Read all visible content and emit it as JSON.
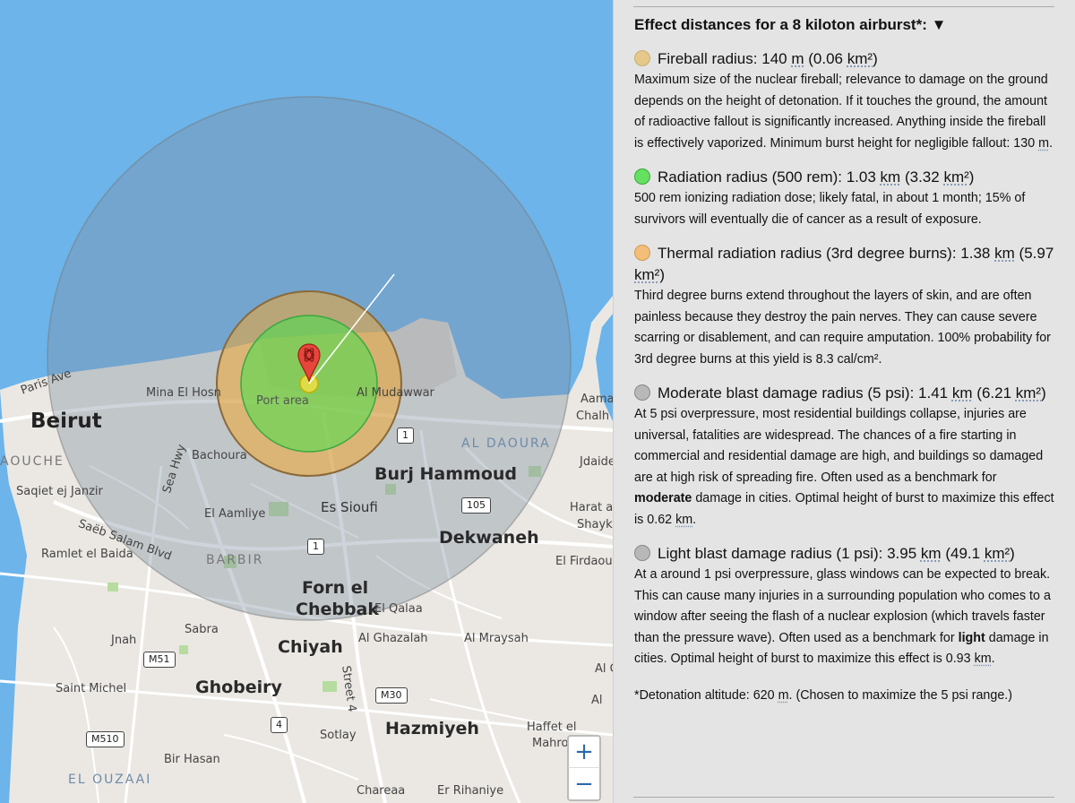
{
  "map": {
    "labels": {
      "beirut": "Beirut",
      "paris_ave": "Paris Ave",
      "mina_el_hosn": "Mina El Hosn",
      "port_area": "Port area",
      "al_mudawwar": "Al Mudawwar",
      "aouche": "AOUCHE",
      "bachoura": "Bachoura",
      "saqiet": "Saqiet ej Janzir",
      "sea_hwy": "Sea Hwy",
      "el_aamliye": "El Aamliye",
      "es_sioufi": "Es Sioufi",
      "burj_hammoud": "Burj Hammoud",
      "al_daoura": "AL DAOURA",
      "jdaide": "Jdaide",
      "aama": "Aama",
      "chalh": "Chalh",
      "saeb_salam": "Saëb Salam Blvd",
      "ramlet": "Ramlet el Baida",
      "barbir": "BARBIR",
      "dekwaneh": "Dekwaneh",
      "harat": "Harat a",
      "shayk": "Shayk",
      "el_firdaou": "El Firdaou",
      "forn_el": "Forn el",
      "chebbak": "Chebbak",
      "el_qalaa": "El Qalaa",
      "jnah": "Jnah",
      "sabra": "Sabra",
      "chiyah": "Chiyah",
      "al_ghazalah": "Al Ghazalah",
      "al_mraysah": "Al Mraysah",
      "saint_michel": "Saint Michel",
      "ghobeiry": "Ghobeiry",
      "street4": "Street 4",
      "hazmiyeh": "Hazmiyeh",
      "haffet_el": "Haffet el",
      "mahrou": "Mahrou",
      "sotlay": "Sotlay",
      "bir_hasan": "Bir Hasan",
      "el_ouzaai": "EL OUZAAI",
      "chareaa": "Chareaa",
      "er_rihaniye": "Er Rihaniye",
      "al_c": "Al C",
      "al": "Al"
    },
    "shields": {
      "s1a": "1",
      "s1b": "1",
      "s105": "105",
      "m51": "M51",
      "m30": "M30",
      "s4": "4",
      "m510": "M510"
    },
    "zoom_in": "+",
    "zoom_out": "−",
    "colors": {
      "sea": "#6cb4ea",
      "blast_light": "#7f8fa0",
      "thermal": "#f0a832",
      "radiation": "#44e04a",
      "fireball": "#f5e045"
    }
  },
  "panel": {
    "header": "Effect distances for a 8 kiloton airburst*:",
    "toggle_icon": "▼",
    "effects": [
      {
        "color": "#e5c88a",
        "title": "Fireball radius:",
        "value": "140",
        "unit": "m",
        "area_prefix": "(0.06",
        "area_unit": "km²",
        "area_suffix": ")",
        "desc_pre": "Maximum size of the nuclear fireball; relevance to damage on the ground depends on the height of detonation. If it touches the ground, the amount of radioactive fallout is significantly increased. Anything inside the fireball is effectively vaporized. Minimum burst height for negligible fallout: 130",
        "desc_unit": "m",
        "desc_post": "."
      },
      {
        "color": "#66e060",
        "title": "Radiation radius (500 rem):",
        "value": "1.03",
        "unit": "km",
        "area_prefix": "(3.32",
        "area_unit": "km²",
        "area_suffix": ")",
        "desc": "500 rem ionizing radiation dose; likely fatal, in about 1 month; 15% of survivors will eventually die of cancer as a result of exposure."
      },
      {
        "color": "#f2be7a",
        "title": "Thermal radiation radius (3rd degree burns):",
        "value": "1.38",
        "unit": "km",
        "area_prefix": "(5.97",
        "area_unit": "km²",
        "area_suffix": ")",
        "desc": "Third degree burns extend throughout the layers of skin, and are often painless because they destroy the pain nerves. They can cause severe scarring or disablement, and can require amputation. 100% probability for 3rd degree burns at this yield is 8.3 cal/cm²."
      },
      {
        "color": "#b8b8b8",
        "title": "Moderate blast damage radius (5 psi):",
        "value": "1.41",
        "unit": "km",
        "area_prefix": "(6.21",
        "area_unit": "km²",
        "area_suffix": ")",
        "desc_pre": "At 5 psi overpressure, most residential buildings collapse, injuries are universal, fatalities are widespread. The chances of a fire starting in commercial and residential damage are high, and buildings so damaged are at high risk of spreading fire. Often used as a benchmark for",
        "desc_bold": "moderate",
        "desc_mid": "damage in cities. Optimal height of burst to maximize this effect is 0.62",
        "desc_unit": "km",
        "desc_post": "."
      },
      {
        "color": "#b8b8b8",
        "title": "Light blast damage radius (1 psi):",
        "value": "3.95",
        "unit": "km",
        "area_prefix": "(49.1",
        "area_unit": "km²",
        "area_suffix": ")",
        "desc_pre": "At a around 1 psi overpressure, glass windows can be expected to break. This can cause many injuries in a surrounding population who comes to a window after seeing the flash of a nuclear explosion (which travels faster than the pressure wave). Often used as a benchmark for",
        "desc_bold": "light",
        "desc_mid": "damage in cities. Optimal height of burst to maximize this effect is 0.93",
        "desc_unit": "km",
        "desc_post": "."
      }
    ],
    "footnote_pre": "*Detonation altitude: 620",
    "footnote_unit": "m",
    "footnote_post": ". (Chosen to maximize the 5 psi range.)"
  }
}
